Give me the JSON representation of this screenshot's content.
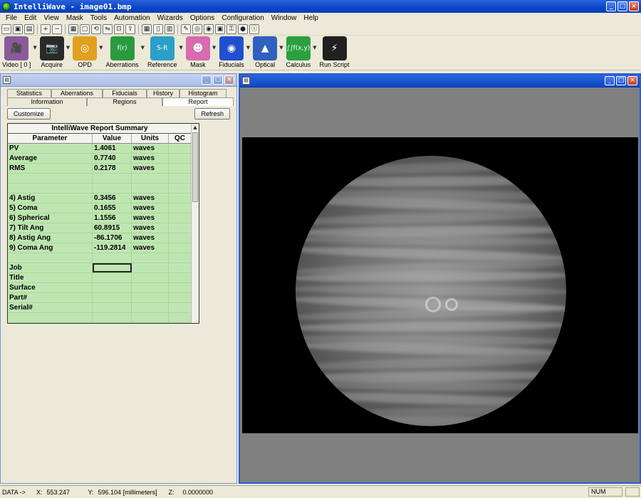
{
  "app": {
    "title": "IntelliWave - image01.bmp",
    "window_buttons": {
      "minimize": "_",
      "maximize": "□",
      "close": "×"
    }
  },
  "menu": [
    "File",
    "Edit",
    "View",
    "Mask",
    "Tools",
    "Automation",
    "Wizards",
    "Options",
    "Configuration",
    "Window",
    "Help"
  ],
  "toolbar1": [
    "open-icon",
    "save-icon",
    "print-icon",
    "zoom-in-icon",
    "zoom-out-icon",
    "grid-icon",
    "fit-icon",
    "rotate-icon",
    "flip-icon",
    "crop-icon",
    "export-icon",
    "table-icon",
    "doc-icon",
    "report-icon",
    "pen-icon",
    "target-icon",
    "eye-icon",
    "camera-icon",
    "lock-icon",
    "record-icon",
    "info-icon"
  ],
  "toolbar2": [
    {
      "label": "Video [ 0 ]",
      "icon": "video-camera-icon",
      "color": "#8a5a9a",
      "dropdown": true
    },
    {
      "label": "Acquire",
      "icon": "camera-icon",
      "color": "#2a2a2a",
      "dropdown": true
    },
    {
      "label": "OPD",
      "icon": "opd-icon",
      "color": "#e0a020",
      "dropdown": true
    },
    {
      "label": "Aberrations",
      "icon": "aberrations-icon",
      "color": "#2a9a40",
      "dropdown": true
    },
    {
      "label": "Reference",
      "icon": "sr-icon",
      "color": "#2aa0c8",
      "dropdown": true
    },
    {
      "label": "Mask",
      "icon": "mask-icon",
      "color": "#d86ab0",
      "dropdown": true
    },
    {
      "label": "Fiducials",
      "icon": "fiducials-icon",
      "color": "#2050d0",
      "dropdown": true
    },
    {
      "label": "Optical",
      "icon": "optical-icon",
      "color": "#3060c0",
      "dropdown": true
    },
    {
      "label": "Calculus",
      "icon": "calculus-icon",
      "color": "#2aa040",
      "dropdown": true
    },
    {
      "label": "Run Script",
      "icon": "script-icon",
      "color": "#202020",
      "dropdown": false
    }
  ],
  "calculus_glyph": "∫∫f(x,y) dx dy",
  "aberrations_glyph": "f(r)",
  "reference_glyph": "S-R",
  "tabs_row1": [
    "Statistics",
    "Aberrations",
    "Fiducials",
    "History",
    "Histogram"
  ],
  "tabs_row2": [
    "Information",
    "Regions",
    "Report"
  ],
  "active_tab": "Report",
  "buttons": {
    "customize": "Customize",
    "refresh": "Refresh"
  },
  "report": {
    "title": "IntelliWave Report Summary",
    "columns": [
      "Parameter",
      "Value",
      "Units",
      "QC"
    ],
    "rows": [
      {
        "param": "PV",
        "value": "1.4061",
        "units": "waves",
        "qc": ""
      },
      {
        "param": "Average",
        "value": "0.7740",
        "units": "waves",
        "qc": ""
      },
      {
        "param": "RMS",
        "value": "0.2178",
        "units": "waves",
        "qc": ""
      },
      {
        "param": "",
        "value": "",
        "units": "",
        "qc": ""
      },
      {
        "param": "",
        "value": "",
        "units": "",
        "qc": ""
      },
      {
        "param": " 4) Astig",
        "value": "0.3456",
        "units": "waves",
        "qc": ""
      },
      {
        "param": " 5) Coma",
        "value": "0.1655",
        "units": "waves",
        "qc": ""
      },
      {
        "param": " 6) Spherical",
        "value": "1.1556",
        "units": "waves",
        "qc": ""
      },
      {
        "param": " 7) Tilt Ang",
        "value": "60.8915",
        "units": "waves",
        "qc": ""
      },
      {
        "param": " 8) Astig Ang",
        "value": "-86.1706",
        "units": "waves",
        "qc": ""
      },
      {
        "param": " 9) Coma Ang",
        "value": "-119.2814",
        "units": "waves",
        "qc": ""
      },
      {
        "param": "",
        "value": "",
        "units": "",
        "qc": ""
      },
      {
        "param": "Job",
        "value": "",
        "units": "",
        "qc": "",
        "selected": true
      },
      {
        "param": "Title",
        "value": "",
        "units": "",
        "qc": ""
      },
      {
        "param": "Surface",
        "value": "",
        "units": "",
        "qc": ""
      },
      {
        "param": "Part#",
        "value": "",
        "units": "",
        "qc": ""
      },
      {
        "param": "Serial#",
        "value": "",
        "units": "",
        "qc": ""
      },
      {
        "param": "",
        "value": "",
        "units": "",
        "qc": ""
      }
    ]
  },
  "status": {
    "mode": "DATA ->",
    "x_label": "X:",
    "x_value": "553.247",
    "y_label": "Y:",
    "y_value": "596.104 [millimeters]",
    "z_label": "Z:",
    "z_value": "0.0000000",
    "num": "NUM"
  }
}
